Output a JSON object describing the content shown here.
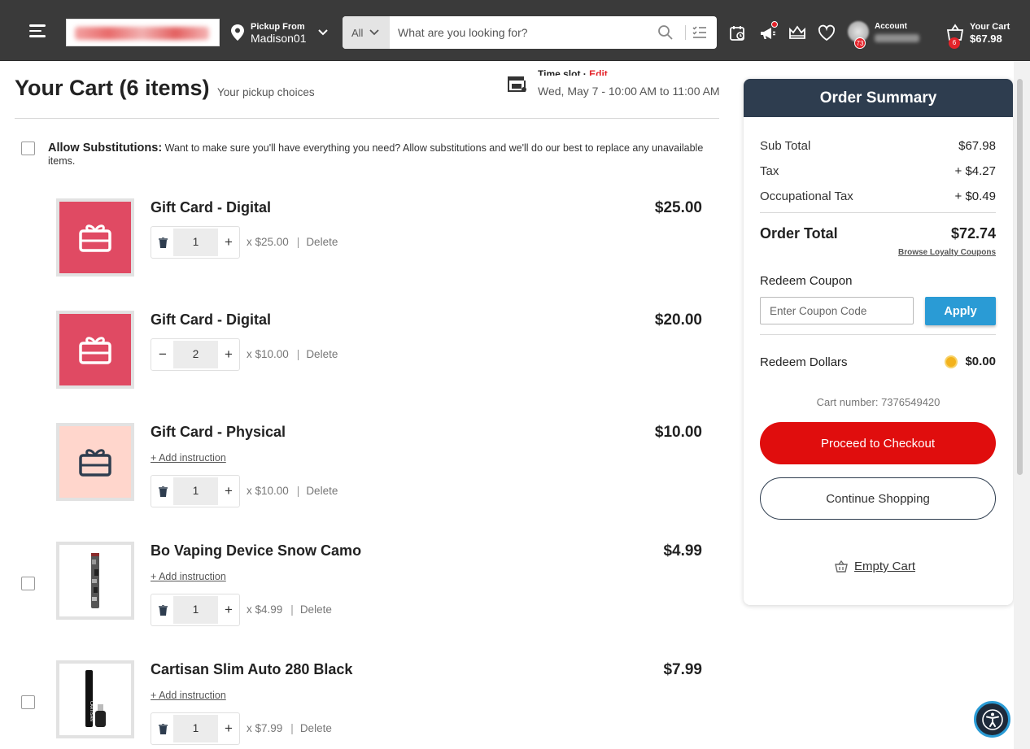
{
  "header": {
    "pickup_label": "Pickup From",
    "store_name": "Madison01",
    "search_category": "All",
    "search_placeholder": "What are you looking for?",
    "account_label": "Account",
    "account_badge": "73",
    "cart_label": "Your Cart",
    "cart_total": "$67.98",
    "cart_count": "6"
  },
  "page": {
    "title": "Your Cart (6 items)",
    "subtitle": "Your pickup choices",
    "timeslot_label": "Time slot",
    "timeslot_edit": "Edit",
    "timeslot_time": "Wed, May 7 - 10:00 AM to 11:00 AM",
    "substitutions_title": "Allow Substitutions:",
    "substitutions_text": "Want to make sure you'll have everything you need? Allow substitutions and we'll do our best to replace any unavailable items."
  },
  "items": [
    {
      "name": "Gift Card - Digital",
      "price": "$25.00",
      "qty": "1",
      "unit": "x $25.00",
      "delete": "Delete",
      "instruction": ""
    },
    {
      "name": "Gift Card - Digital",
      "price": "$20.00",
      "qty": "2",
      "unit": "x $10.00",
      "delete": "Delete",
      "instruction": ""
    },
    {
      "name": "Gift Card - Physical",
      "price": "$10.00",
      "qty": "1",
      "unit": "x $10.00",
      "delete": "Delete",
      "instruction": "+ Add instruction"
    },
    {
      "name": "Bo Vaping Device Snow Camo",
      "price": "$4.99",
      "qty": "1",
      "unit": "x $4.99",
      "delete": "Delete",
      "instruction": "+ Add instruction"
    },
    {
      "name": "Cartisan Slim Auto 280 Black",
      "price": "$7.99",
      "qty": "1",
      "unit": "x $7.99",
      "delete": "Delete",
      "instruction": "+ Add instruction"
    }
  ],
  "summary": {
    "title": "Order Summary",
    "subtotal_label": "Sub Total",
    "subtotal": "$67.98",
    "tax_label": "Tax",
    "tax": "+ $4.27",
    "occ_tax_label": "Occupational Tax",
    "occ_tax": "+ $0.49",
    "order_total_label": "Order Total",
    "order_total": "$72.74",
    "loyalty_link": "Browse Loyalty Coupons",
    "redeem_coupon_label": "Redeem Coupon",
    "coupon_placeholder": "Enter Coupon Code",
    "apply_label": "Apply",
    "redeem_dollars_label": "Redeem Dollars",
    "redeem_dollars_value": "$0.00",
    "cart_number": "Cart number: 7376549420",
    "checkout_label": "Proceed to Checkout",
    "continue_label": "Continue Shopping",
    "empty_cart_label": "Empty Cart"
  },
  "colors": {
    "header_bg": "#3a3a3a",
    "summary_header": "#2e3d4f",
    "checkout_red": "#e00d0d",
    "apply_blue": "#2a9bd5",
    "gift_digital": "#e04a63",
    "gift_physical": "#ffd6cc"
  }
}
